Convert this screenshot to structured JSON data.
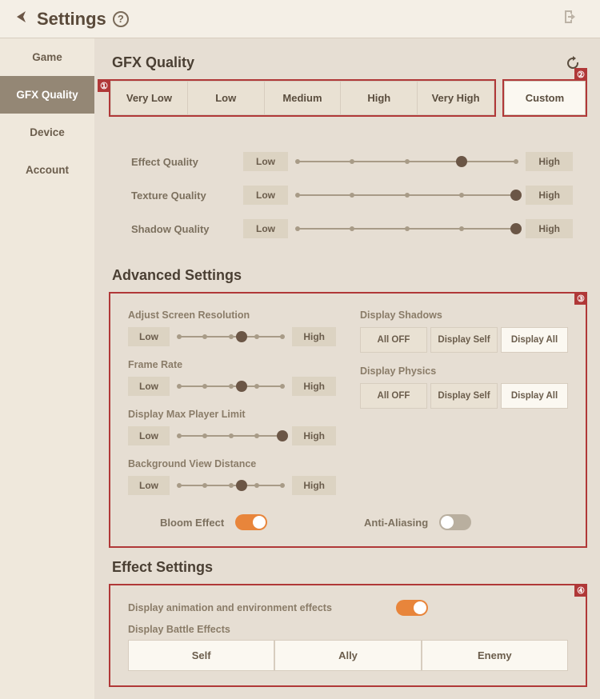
{
  "header": {
    "title": "Settings"
  },
  "nav": [
    "Game",
    "GFX Quality",
    "Device",
    "Account"
  ],
  "nav_active": 1,
  "gfx": {
    "title": "GFX Quality",
    "presets": [
      "Very Low",
      "Low",
      "Medium",
      "High",
      "Very High"
    ],
    "custom": "Custom",
    "rows": [
      {
        "label": "Effect Quality",
        "low": "Low",
        "high": "High",
        "knob": 75
      },
      {
        "label": "Texture Quality",
        "low": "Low",
        "high": "High",
        "knob": 100
      },
      {
        "label": "Shadow Quality",
        "low": "Low",
        "high": "High",
        "knob": 100
      }
    ]
  },
  "advanced": {
    "title": "Advanced Settings",
    "sliders": [
      {
        "label": "Adjust Screen Resolution",
        "low": "Low",
        "high": "High",
        "knob": 60
      },
      {
        "label": "Frame Rate",
        "low": "Low",
        "high": "High",
        "knob": 60
      },
      {
        "label": "Display Max Player Limit",
        "low": "Low",
        "high": "High",
        "knob": 100
      },
      {
        "label": "Background View Distance",
        "low": "Low",
        "high": "High",
        "knob": 60
      }
    ],
    "options": [
      {
        "label": "Display Shadows",
        "buttons": [
          "All OFF",
          "Display Self",
          "Display All"
        ],
        "active": 2
      },
      {
        "label": "Display Physics",
        "buttons": [
          "All OFF",
          "Display Self",
          "Display All"
        ],
        "active": 2
      }
    ],
    "toggles": [
      {
        "label": "Bloom Effect",
        "on": true
      },
      {
        "label": "Anti-Aliasing",
        "on": false
      }
    ]
  },
  "effect": {
    "title": "Effect Settings",
    "anim_label": "Display animation and environment effects",
    "anim_on": true,
    "battle_label": "Display Battle Effects",
    "battle_buttons": [
      "Self",
      "Ally",
      "Enemy"
    ]
  },
  "callouts": [
    "①",
    "②",
    "③",
    "④"
  ]
}
